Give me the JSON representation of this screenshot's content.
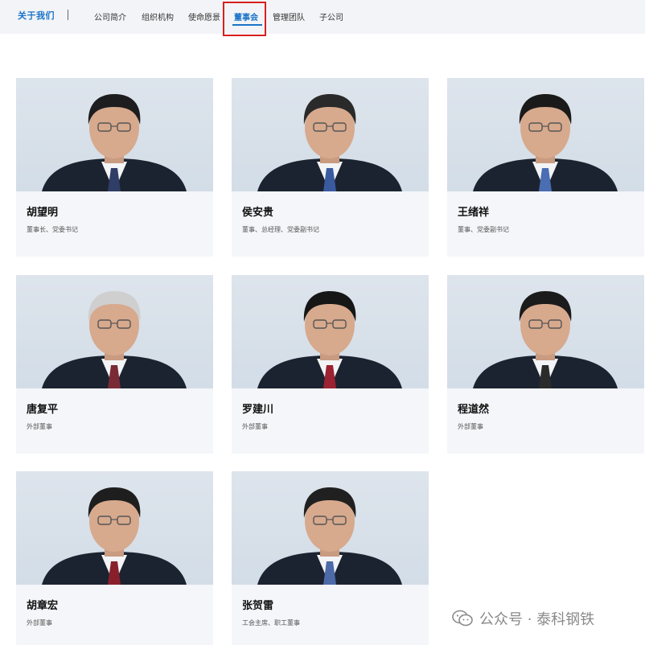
{
  "header": {
    "brand": "关于我们",
    "nav": [
      {
        "label": "公司简介",
        "active": false
      },
      {
        "label": "组织机构",
        "active": false
      },
      {
        "label": "使命愿景",
        "active": false
      },
      {
        "label": "董事会",
        "active": true
      },
      {
        "label": "管理团队",
        "active": false
      },
      {
        "label": "子公司",
        "active": false
      }
    ]
  },
  "members": [
    {
      "name": "胡望明",
      "title": "董事长、党委书记"
    },
    {
      "name": "侯安贵",
      "title": "董事、总经理、党委副书记"
    },
    {
      "name": "王绪祥",
      "title": "董事、党委副书记"
    },
    {
      "name": "唐复平",
      "title": "外部董事"
    },
    {
      "name": "罗建川",
      "title": "外部董事"
    },
    {
      "name": "程道然",
      "title": "外部董事"
    },
    {
      "name": "胡章宏",
      "title": "外部董事"
    },
    {
      "name": "张贺雷",
      "title": "工会主席、职工董事"
    }
  ],
  "watermark": {
    "text": "公众号 · 泰科钢铁",
    "icon": "wechat-icon"
  },
  "colors": {
    "accent": "#1a73c9",
    "highlight": "#d7201d",
    "card_bg": "#f4f6f9"
  }
}
